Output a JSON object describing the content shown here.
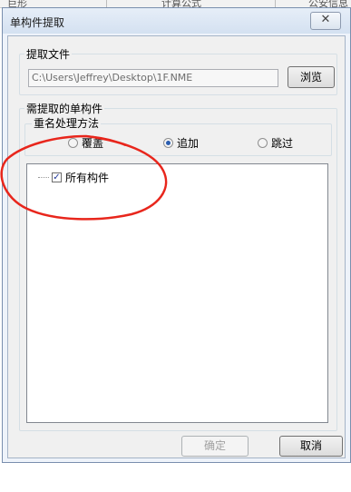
{
  "background": {
    "col_left": "巨形",
    "col_mid": "计算公式",
    "col_right": "公安信息"
  },
  "dialog": {
    "title": "单构件提取",
    "close_symbol": "✕"
  },
  "file_section": {
    "label": "提取文件",
    "path_value": "C:\\Users\\Jeffrey\\Desktop\\1F.NME",
    "browse_label": "浏览"
  },
  "components_section": {
    "label": "需提取的单构件"
  },
  "rename_section": {
    "label": "重名处理方法",
    "options": [
      {
        "label": "覆盖",
        "selected": false
      },
      {
        "label": "追加",
        "selected": true
      },
      {
        "label": "跳过",
        "selected": false
      }
    ]
  },
  "tree": {
    "items": [
      {
        "label": "所有构件",
        "checked": true
      }
    ]
  },
  "buttons": {
    "ok_label": "确定",
    "cancel_label": "取消"
  },
  "colors": {
    "annotation_stroke": "#e8261c",
    "accent_radio": "#2a5db0"
  }
}
